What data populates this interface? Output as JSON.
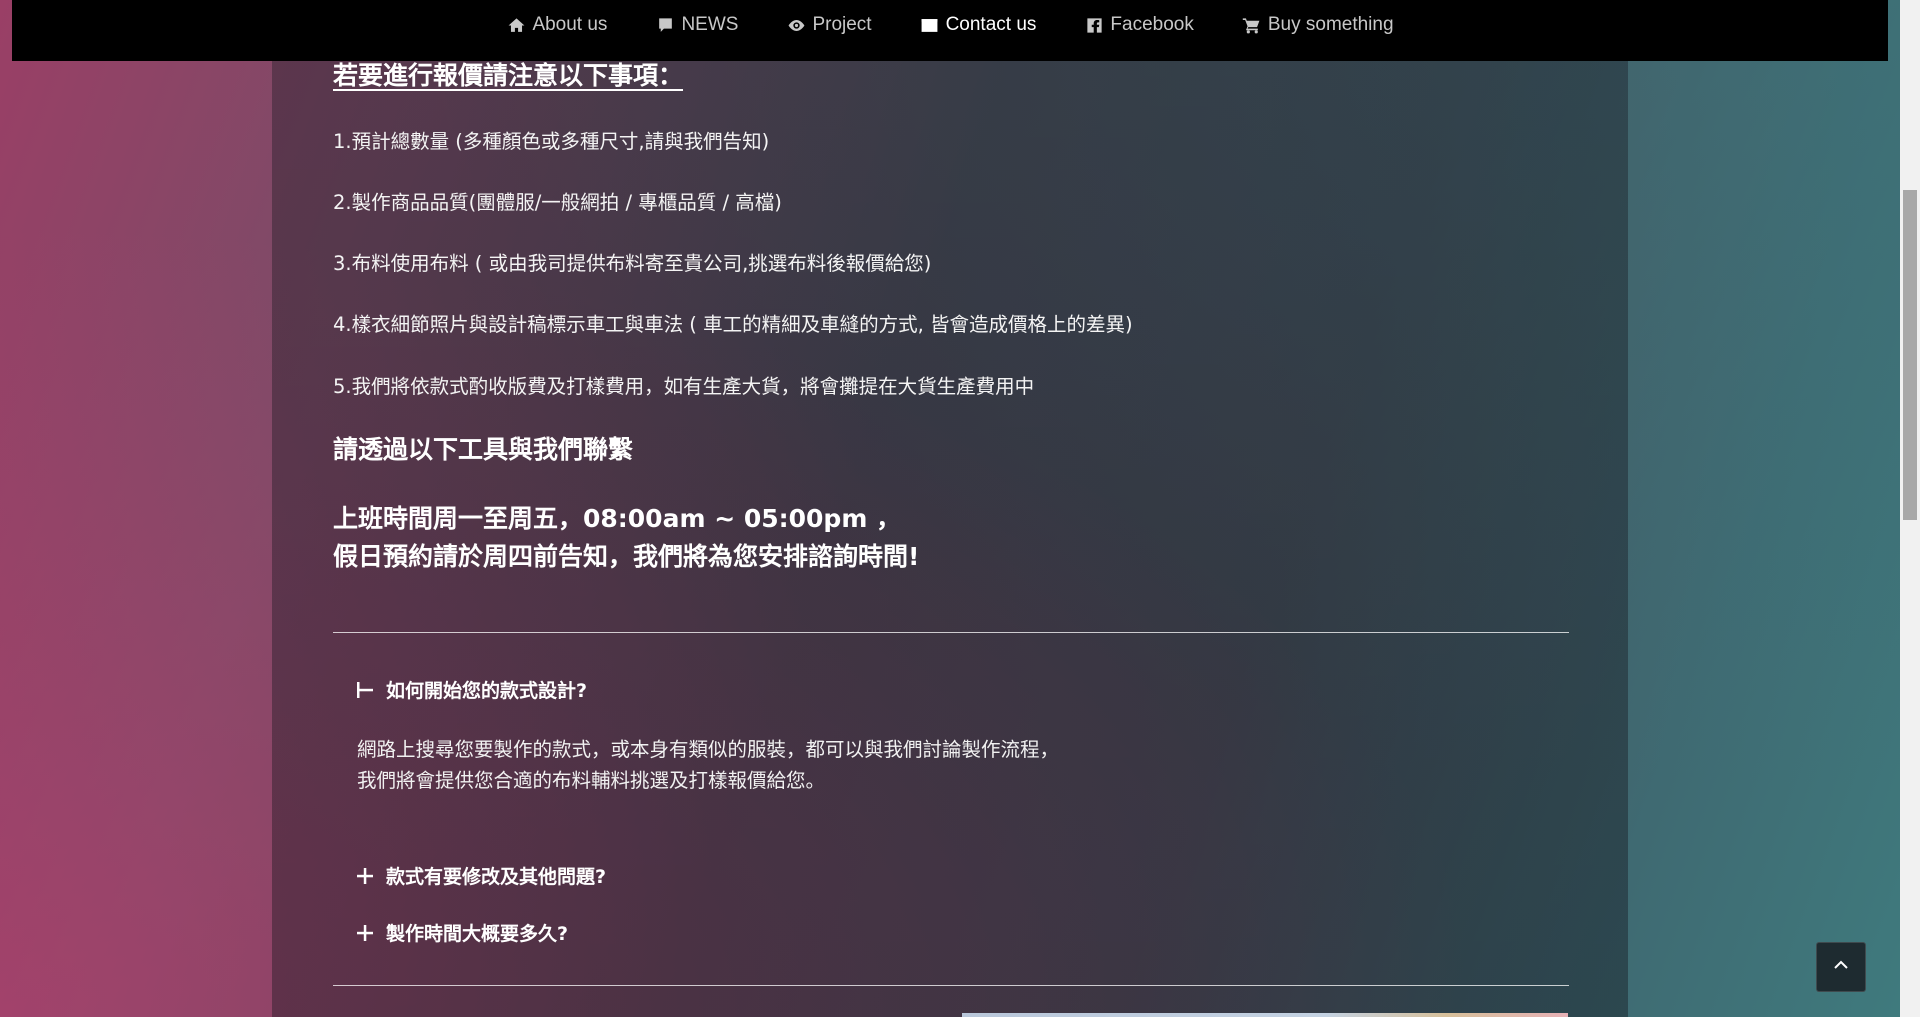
{
  "nav": {
    "items": [
      {
        "label": "About us",
        "icon": "home-icon"
      },
      {
        "label": "NEWS",
        "icon": "comment-icon"
      },
      {
        "label": "Project",
        "icon": "eye-icon"
      },
      {
        "label": "Contact us",
        "icon": "envelope-icon",
        "active": true
      },
      {
        "label": "Facebook",
        "icon": "facebook-icon"
      },
      {
        "label": "Buy something",
        "icon": "cart-icon"
      }
    ]
  },
  "notice": {
    "heading": "若要進行報價請注意以下事項：",
    "items": [
      "1.預計總數量 (多種顏色或多種尺寸,請與我們告知)",
      "2.製作商品品質(團體服/一般網拍 / 專櫃品質 / 高檔)",
      "3.布料使用布料 ( 或由我司提供布料寄至貴公司,挑選布料後報價給您)",
      "4.樣衣細節照片與設計稿標示車工與車法 ( 車工的精細及車縫的方式, 皆會造成價格上的差異)",
      "5.我們將依款式酌收版費及打樣費用，如有生產大貨，將會攤提在大貨生產費用中"
    ]
  },
  "contact": {
    "title": "請透過以下工具與我們聯繫",
    "hours_line1": "上班時間周一至周五，08:00am ~ 05:00pm ，",
    "hours_line2": "假日預約請於周四前告知，我們將為您安排諮詢時間!"
  },
  "faq": {
    "items": [
      {
        "title": "如何開始您的款式設計?",
        "expanded": true,
        "body_line1": "網路上搜尋您要製作的款式，或本身有類似的服裝，都可以與我們討論製作流程，",
        "body_line2": "我們將會提供您合適的布料輔料挑選及打樣報價給您。"
      },
      {
        "title": "款式有要修改及其他問題?",
        "expanded": false
      },
      {
        "title": "製作時間大概要多久?",
        "expanded": false
      }
    ]
  },
  "colors": {
    "navbar": "#000000",
    "text": "#ffffff",
    "nav_inactive": "#c8c8c8"
  }
}
